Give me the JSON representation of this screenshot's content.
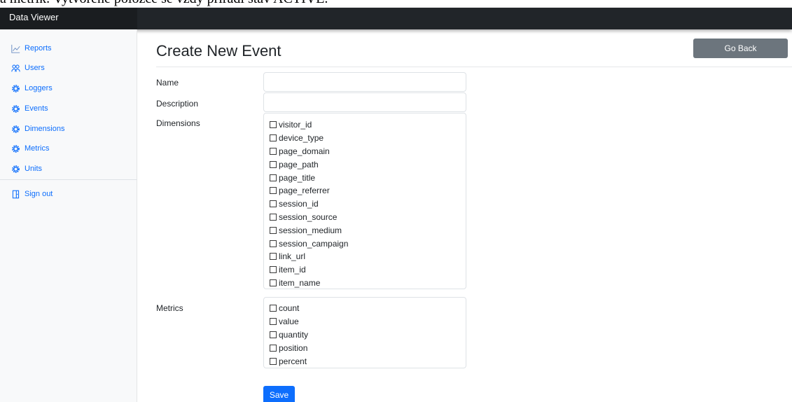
{
  "document_fragment": "a metrik. Vytvořené položce se vždy přiřadí stav ACTIVE.",
  "app": {
    "title": "Data Viewer"
  },
  "sidebar": {
    "items": [
      {
        "label": "Reports",
        "icon": "chart-line-icon"
      },
      {
        "label": "Users",
        "icon": "users-icon"
      },
      {
        "label": "Loggers",
        "icon": "gear-icon"
      },
      {
        "label": "Events",
        "icon": "gear-icon"
      },
      {
        "label": "Dimensions",
        "icon": "gear-icon"
      },
      {
        "label": "Metrics",
        "icon": "gear-icon"
      },
      {
        "label": "Units",
        "icon": "gear-icon"
      }
    ],
    "sign_out": {
      "label": "Sign out",
      "icon": "sign-out-icon"
    }
  },
  "page": {
    "title": "Create New Event",
    "go_back_label": "Go Back",
    "save_label": "Save"
  },
  "form": {
    "name": {
      "label": "Name",
      "value": "",
      "placeholder": ""
    },
    "description": {
      "label": "Description",
      "value": "",
      "placeholder": ""
    },
    "dimensions": {
      "label": "Dimensions",
      "options": [
        "visitor_id",
        "device_type",
        "page_domain",
        "page_path",
        "page_title",
        "page_referrer",
        "session_id",
        "session_source",
        "session_medium",
        "session_campaign",
        "link_url",
        "item_id",
        "item_name"
      ],
      "checked": []
    },
    "metrics": {
      "label": "Metrics",
      "options": [
        "count",
        "value",
        "quantity",
        "position",
        "percent"
      ],
      "checked": []
    }
  },
  "colors": {
    "topbar": "#212529",
    "sidebar_bg": "#f8f9fa",
    "link": "#0d6efd",
    "secondary_button": "#6c757d",
    "primary_button": "#0d6efd"
  }
}
